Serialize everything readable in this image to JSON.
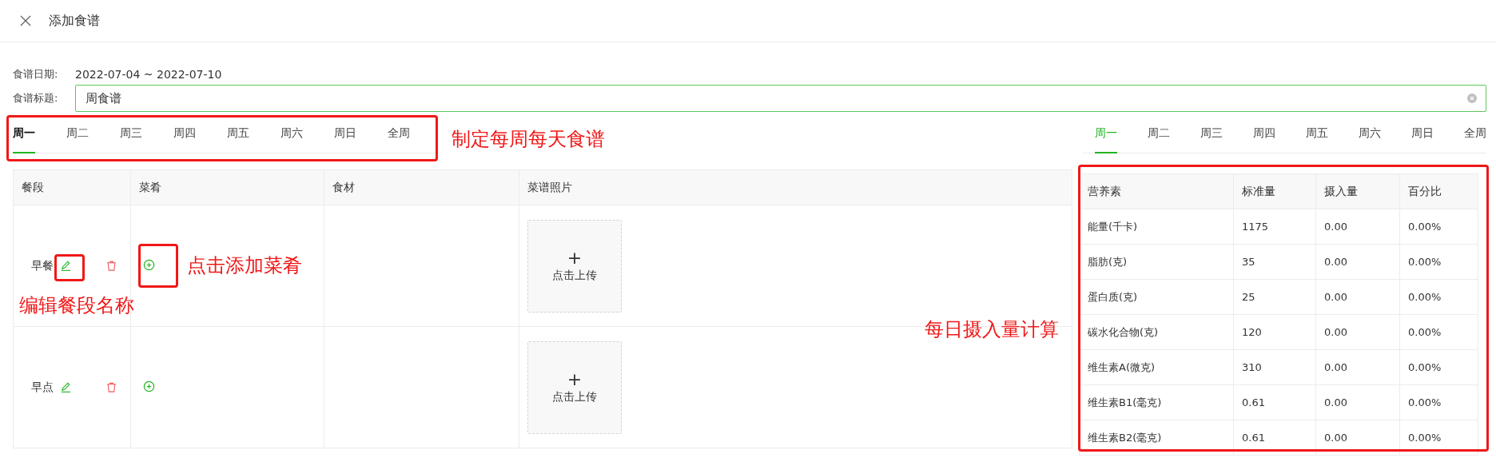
{
  "window": {
    "title": "添加食谱"
  },
  "form": {
    "date_label": "食谱日期:",
    "date_value": "2022-07-04 ~ 2022-07-10",
    "title_label": "食谱标题:",
    "title_value": "周食谱"
  },
  "day_tabs": [
    {
      "label": "周一",
      "selected": true
    },
    {
      "label": "周二",
      "selected": false
    },
    {
      "label": "周三",
      "selected": false
    },
    {
      "label": "周四",
      "selected": false
    },
    {
      "label": "周五",
      "selected": false
    },
    {
      "label": "周六",
      "selected": false
    },
    {
      "label": "周日",
      "selected": false
    },
    {
      "label": "全周",
      "selected": false
    }
  ],
  "meal_table": {
    "columns": [
      "餐段",
      "菜肴",
      "食材",
      "菜谱照片"
    ],
    "rows": [
      {
        "meal": "早餐",
        "upload_icon": "+",
        "upload_label": "点击上传"
      },
      {
        "meal": "早点",
        "upload_icon": "+",
        "upload_label": "点击上传"
      }
    ]
  },
  "nutrition_tabs": [
    {
      "label": "周一",
      "selected": true
    },
    {
      "label": "周二",
      "selected": false
    },
    {
      "label": "周三",
      "selected": false
    },
    {
      "label": "周四",
      "selected": false
    },
    {
      "label": "周五",
      "selected": false
    },
    {
      "label": "周六",
      "selected": false
    },
    {
      "label": "周日",
      "selected": false
    },
    {
      "label": "全周",
      "selected": false
    }
  ],
  "nutrition_table": {
    "columns": [
      "营养素",
      "标准量",
      "摄入量",
      "百分比"
    ],
    "rows": [
      [
        "能量(千卡)",
        "1175",
        "0.00",
        "0.00%"
      ],
      [
        "脂肪(克)",
        "35",
        "0.00",
        "0.00%"
      ],
      [
        "蛋白质(克)",
        "25",
        "0.00",
        "0.00%"
      ],
      [
        "碳水化合物(克)",
        "120",
        "0.00",
        "0.00%"
      ],
      [
        "维生素A(微克)",
        "310",
        "0.00",
        "0.00%"
      ],
      [
        "维生素B1(毫克)",
        "0.61",
        "0.00",
        "0.00%"
      ],
      [
        "维生素B2(毫克)",
        "0.61",
        "0.00",
        "0.00%"
      ]
    ]
  },
  "annotations": [
    "制定每周每天食谱",
    "点击添加菜肴",
    "编辑餐段名称",
    "每日摄入量计算"
  ]
}
